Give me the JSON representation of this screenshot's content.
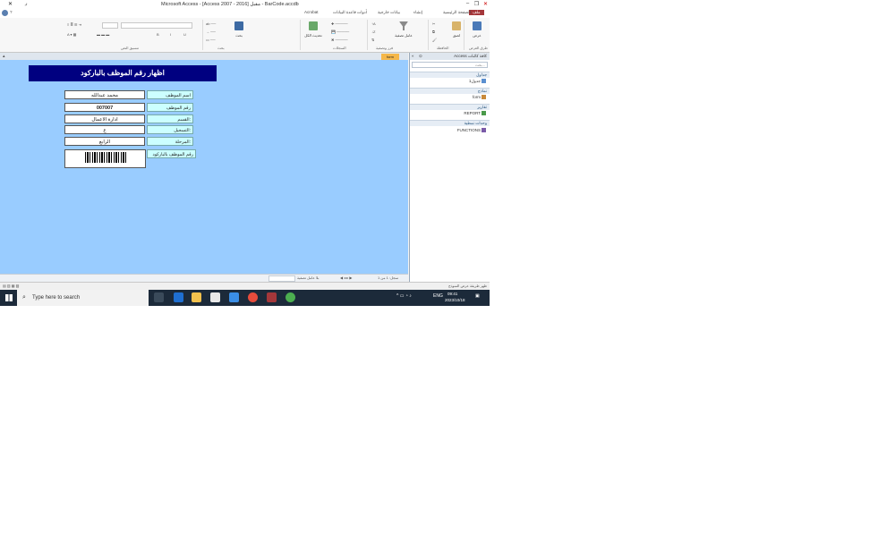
{
  "window": {
    "title": "Microsoft Access - [Access 2007 - 2016] مقبل - BarCode.accdb",
    "minimize": "–",
    "restore": "❐",
    "close": "✕",
    "close_doc": "✕",
    "doc_restore": "ﺭ",
    "help": "?"
  },
  "tabs": [
    {
      "label": "ملف",
      "active": true
    },
    {
      "label": "الصفحة الرئيسية"
    },
    {
      "label": "إنشاء"
    },
    {
      "label": "بيانات خارجية"
    },
    {
      "label": "أدوات قاعدة البيانات"
    },
    {
      "label": "Acrobat"
    }
  ],
  "ribbon": {
    "groups": [
      "طرق العرض",
      "الحافظة",
      "فرز وتصفية",
      "السجلات",
      "بحث",
      "تنسيق النص"
    ],
    "view_label": "عرض",
    "paste_label": "لصق",
    "filter_label": "عامل تصفية",
    "refresh_label": "تحديث الكل",
    "find_label": "بحث"
  },
  "form": {
    "tab_label": "form",
    "title": "اظهار رقم الموظف بالباركود",
    "fields": [
      {
        "label": "اسم الموظف",
        "value": "محمد عبدالله"
      },
      {
        "label": "رقم الموظف",
        "value": "007007"
      },
      {
        "label": "القسم:",
        "value": "ادارة الاعمال"
      },
      {
        "label": "التسجيل:",
        "value": "ع"
      },
      {
        "label": "المرحلة:",
        "value": "الرابع"
      }
    ],
    "barcode_label": "رقم الموظف بالباركود",
    "record_nav": "سجل: 1 من 1",
    "no_filter": "بلا عامل تصفية",
    "search_label": "بحث"
  },
  "nav_pane": {
    "title": "Access كافة كائنات",
    "search_placeholder": "بحث...",
    "sections": [
      {
        "label": "جداول",
        "items": [
          "جدول1"
        ]
      },
      {
        "label": "نماذج",
        "items": [
          "form"
        ]
      },
      {
        "label": "تقارير",
        "items": [
          "REPORT"
        ]
      },
      {
        "label": "وحدات نمطية",
        "items": [
          "FUNCTIONS"
        ]
      }
    ]
  },
  "status": {
    "left": "",
    "right": "ظهر طريقة عرض النموذج"
  },
  "taskbar": {
    "search_placeholder": "Type here to search",
    "language": "ENG",
    "time": "09:41",
    "date": "2023/10/18",
    "start_icon": "windows-logo"
  },
  "colors": {
    "form_background": "#99ccff",
    "title_bar": "#000080",
    "label_background": "#ccffff",
    "access_accent": "#a4373a",
    "taskbar": "#1c2a3a"
  }
}
